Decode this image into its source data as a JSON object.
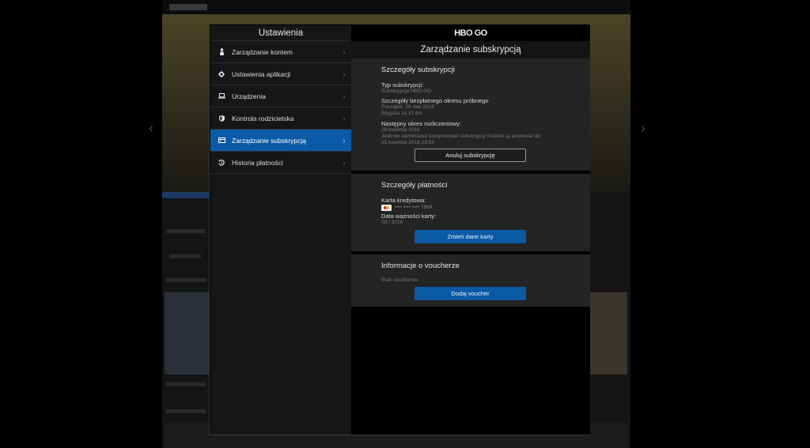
{
  "sidebar": {
    "title": "Ustawienia",
    "items": [
      {
        "label": "Zarządzanie kontem",
        "icon": "person-icon",
        "active": false
      },
      {
        "label": "Ustawienia aplikacji",
        "icon": "gear-icon",
        "active": false
      },
      {
        "label": "Urządzenia",
        "icon": "laptop-icon",
        "active": false
      },
      {
        "label": "Kontrola rodzicielska",
        "icon": "shield-icon",
        "active": false
      },
      {
        "label": "Zarządzanie subskrypcją",
        "icon": "card-icon",
        "active": true
      },
      {
        "label": "Historia płatności",
        "icon": "history-icon",
        "active": false
      }
    ]
  },
  "content": {
    "brand": "HBO GO",
    "title": "Zarządzanie subskrypcją",
    "subscription": {
      "heading": "Szczegóły subskrypcji",
      "type_label": "Typ subskrypcji:",
      "type_value": "Subskrypcja HBO GO",
      "trial_label": "Szczegóły bezpłatnego okresu próbnego",
      "trial_start": "Początek: 26 mar 2018",
      "trial_expires": "Wygasa za 31 dni",
      "next_label": "Następny okres rozliczeniowy:",
      "next_date": "26 kwietnia 2018",
      "cancel_note_1": "Jeśli nie zamierzasz kontynuować subskrypcji możesz ją anulować do",
      "cancel_note_2": "25 kwietnia 2018 23:59",
      "cancel_button": "Anuluj subskrypcję"
    },
    "payment": {
      "heading": "Szczegóły płatności",
      "card_label": "Karta kredytowa:",
      "card_number": "•••• •••• •••• 7869",
      "expiry_label": "Data ważności karty:",
      "expiry_value": "09 / 2018",
      "change_button": "Zmień dane karty"
    },
    "voucher": {
      "heading": "Informacje o voucherze",
      "empty": "Brak voucherów",
      "add_button": "Dodaj voucher"
    }
  },
  "colors": {
    "accent": "#0b5aa6",
    "active_item": "#0a5aa8",
    "panel": "#242424",
    "sidebar": "#161616"
  }
}
